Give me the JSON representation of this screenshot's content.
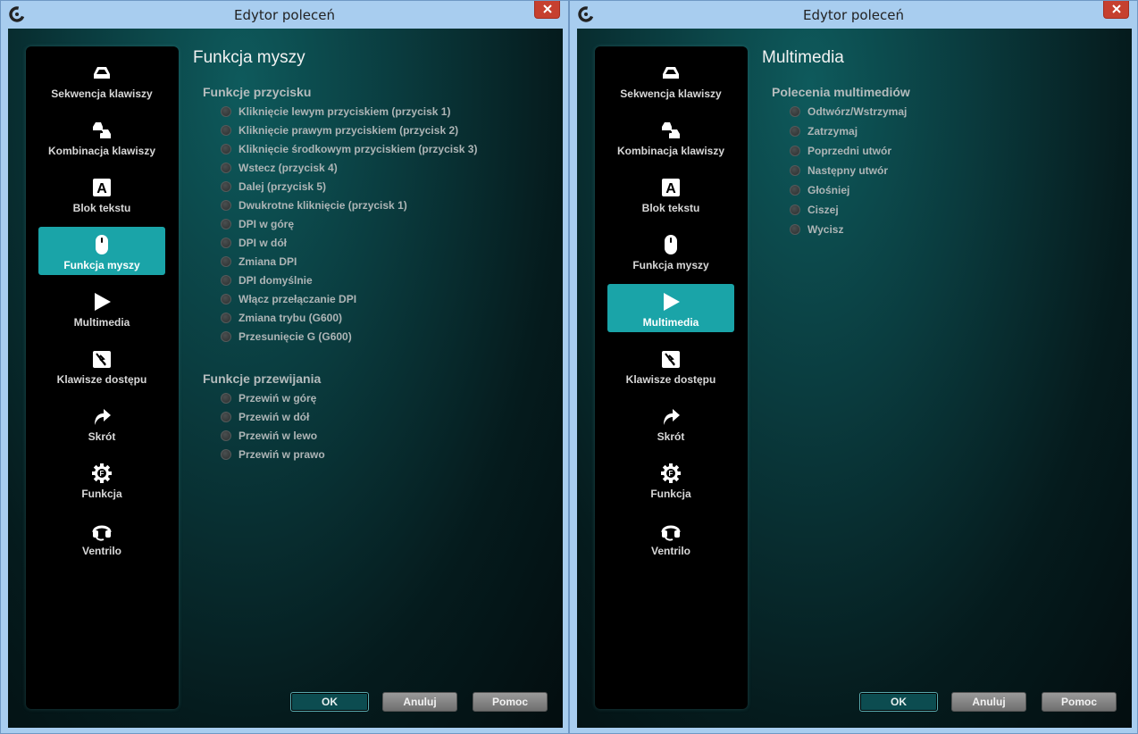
{
  "colors": {
    "accent": "#1aa4a8",
    "close": "#c6402f"
  },
  "nav_icons": [
    "keys-icon",
    "key-combo-icon",
    "text-block-icon",
    "mouse-icon",
    "play-icon",
    "hotkey-icon",
    "shortcut-arrow-icon",
    "function-gear-icon",
    "headset-icon"
  ],
  "windows": [
    {
      "title": "Edytor poleceń",
      "nav": [
        "Sekwencja klawiszy",
        "Kombinacja klawiszy",
        "Blok tekstu",
        "Funkcja myszy",
        "Multimedia",
        "Klawisze dostępu",
        "Skrót",
        "Funkcja",
        "Ventrilo"
      ],
      "active_nav": "Funkcja myszy",
      "heading": "Funkcja myszy",
      "sections": [
        {
          "title": "Funkcje przycisku",
          "options": [
            "Kliknięcie lewym przyciskiem (przycisk 1)",
            "Kliknięcie prawym przyciskiem (przycisk 2)",
            "Kliknięcie środkowym przyciskiem (przycisk 3)",
            "Wstecz (przycisk 4)",
            "Dalej (przycisk 5)",
            "Dwukrotne kliknięcie (przycisk 1)",
            "DPI w górę",
            "DPI w dół",
            "Zmiana DPI",
            "DPI domyślnie",
            "Włącz przełączanie DPI",
            "Zmiana trybu (G600)",
            "Przesunięcie G (G600)"
          ]
        },
        {
          "title": "Funkcje przewijania",
          "options": [
            "Przewiń w górę",
            "Przewiń w dół",
            "Przewiń w lewo",
            "Przewiń w prawo"
          ]
        }
      ],
      "buttons": {
        "ok": "OK",
        "cancel": "Anuluj",
        "help": "Pomoc"
      }
    },
    {
      "title": "Edytor poleceń",
      "nav": [
        "Sekwencja klawiszy",
        "Kombinacja klawiszy",
        "Blok tekstu",
        "Funkcja myszy",
        "Multimedia",
        "Klawisze dostępu",
        "Skrót",
        "Funkcja",
        "Ventrilo"
      ],
      "active_nav": "Multimedia",
      "heading": "Multimedia",
      "sections": [
        {
          "title": "Polecenia multimediów",
          "options": [
            "Odtwórz/Wstrzymaj",
            "Zatrzymaj",
            "Poprzedni utwór",
            "Następny utwór",
            "Głośniej",
            "Ciszej",
            "Wycisz"
          ]
        }
      ],
      "buttons": {
        "ok": "OK",
        "cancel": "Anuluj",
        "help": "Pomoc"
      }
    }
  ]
}
